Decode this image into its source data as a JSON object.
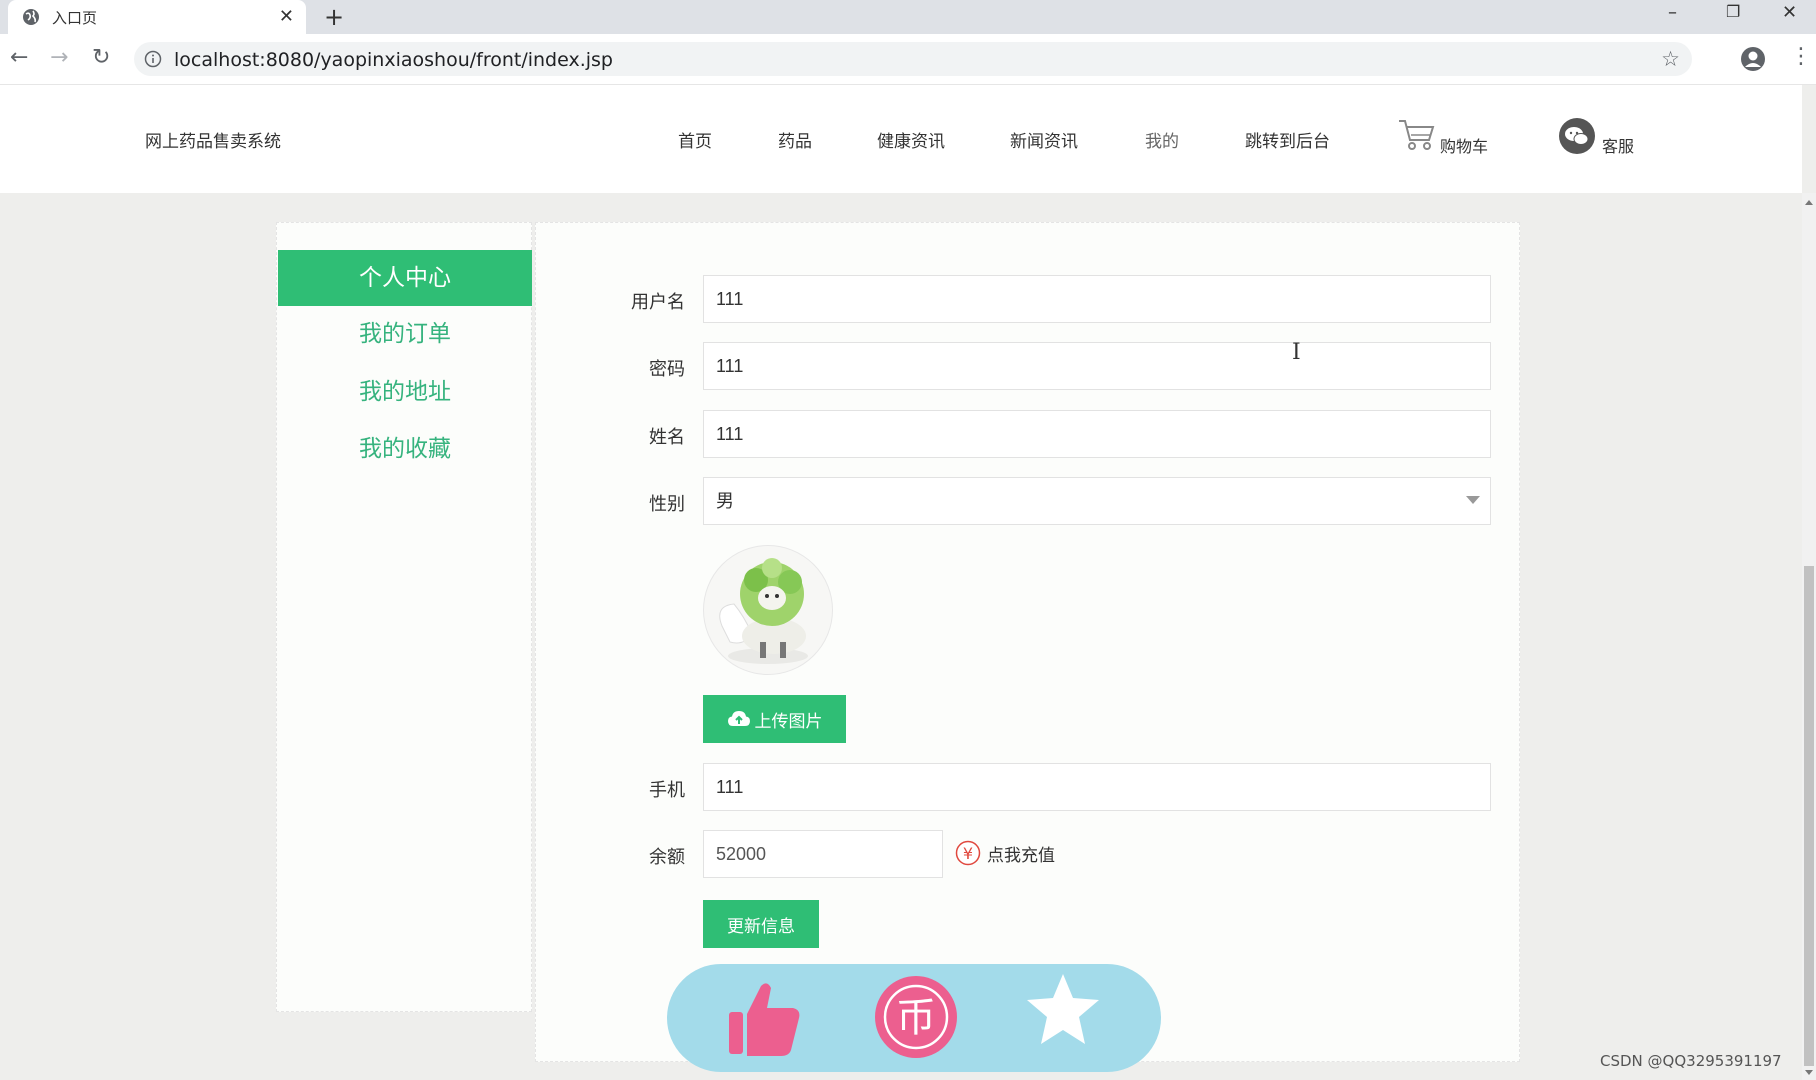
{
  "browser": {
    "tab_title": "入口页",
    "url": "localhost:8080/yaopinxiaoshou/front/index.jsp"
  },
  "header": {
    "brand": "网上药品售卖系统",
    "nav": [
      "首页",
      "药品",
      "健康资讯",
      "新闻资讯",
      "我的",
      "跳转到后台"
    ],
    "cart_label": "购物车",
    "service_label": "客服"
  },
  "sidebar": {
    "items": [
      {
        "label": "个人中心",
        "active": true
      },
      {
        "label": "我的订单",
        "active": false
      },
      {
        "label": "我的地址",
        "active": false
      },
      {
        "label": "我的收藏",
        "active": false
      }
    ]
  },
  "form": {
    "username": {
      "label": "用户名",
      "value": "111"
    },
    "password": {
      "label": "密码",
      "value": "111"
    },
    "name": {
      "label": "姓名",
      "value": "111"
    },
    "gender": {
      "label": "性别",
      "value": "男"
    },
    "upload_label": "上传图片",
    "phone": {
      "label": "手机",
      "value": "111"
    },
    "balance": {
      "label": "余额",
      "value": "52000"
    },
    "recharge_label": "点我充值",
    "recharge_icon": "¥",
    "update_label": "更新信息"
  },
  "reward": {
    "coin_glyph": "币"
  },
  "watermark": "CSDN @QQ3295391197",
  "colors": {
    "accent": "#2fbe75",
    "sidebar_text": "#36b37e",
    "reward_bg": "#a3dbea",
    "reward_pink": "#ec5f8f"
  }
}
